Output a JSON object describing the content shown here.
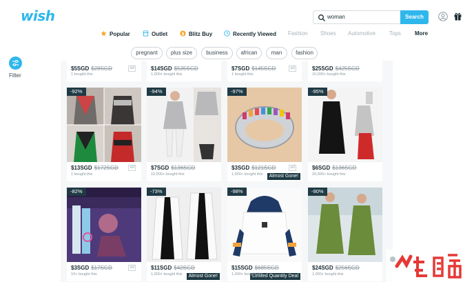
{
  "header": {
    "logo": "wish",
    "search_value": "woman",
    "search_button": "Search"
  },
  "nav": [
    {
      "label": "Popular",
      "style": "strong",
      "icon": "star-icon",
      "color": "#f5a623"
    },
    {
      "label": "Outlet",
      "style": "strong",
      "icon": "store-icon",
      "color": "#2fb7ec"
    },
    {
      "label": "Blitz Buy",
      "style": "strong",
      "icon": "coin-icon",
      "color": "#f5a623"
    },
    {
      "label": "Recently Viewed",
      "style": "strong",
      "icon": "clock-icon",
      "color": "#2fb7ec"
    },
    {
      "label": "Fashion",
      "style": "faded"
    },
    {
      "label": "Shoes",
      "style": "faded"
    },
    {
      "label": "Automotive",
      "style": "faded"
    },
    {
      "label": "Tops",
      "style": "faded"
    },
    {
      "label": "More",
      "style": "strong"
    }
  ],
  "tags": [
    "pregnant",
    "plus size",
    "business",
    "african",
    "man",
    "fashion"
  ],
  "filter": {
    "label": "Filter"
  },
  "products_top": [
    {
      "price": "$5SGD",
      "orig": "$28SGD",
      "bought": "1 bought this",
      "ad": "ad"
    },
    {
      "price": "$14SGD",
      "orig": "$535SGD",
      "bought": "1,000+ bought this"
    },
    {
      "price": "$7SGD",
      "orig": "$145SGD",
      "bought": "1 bought this",
      "ad": "ad"
    },
    {
      "price": "$25SGD",
      "orig": "$425SGD",
      "bought": "10,000+ bought this"
    }
  ],
  "products_row2": [
    {
      "discount": "-92%",
      "price": "$13SGD",
      "orig": "$172SGD",
      "bought": "1 bought this",
      "ad": "ad"
    },
    {
      "discount": "-94%",
      "price": "$7SGD",
      "orig": "$136SGD",
      "bought": "10,000+ bought this"
    },
    {
      "discount": "-97%",
      "price": "$3SGD",
      "orig": "$121SGD",
      "bought": "1,000+ bought this",
      "ad": "ad",
      "badge": "Almost Gone!"
    },
    {
      "discount": "-95%",
      "price": "$6SGD",
      "orig": "$136SGD",
      "bought": "20,000+ bought this"
    }
  ],
  "products_row3": [
    {
      "discount": "-82%",
      "price": "$3SGD",
      "orig": "$17SGD",
      "bought": "10+ bought this",
      "ad": "ad"
    },
    {
      "discount": "-73%",
      "price": "$11SGD",
      "orig": "$42SGD",
      "bought": "1,000+ bought this",
      "badge": "Almost Gone!"
    },
    {
      "discount": "-98%",
      "price": "$15SGD",
      "orig": "$685SGD",
      "bought": "1,000+ bought this",
      "badge": "Limited Quantity Deal"
    },
    {
      "discount": "-90%",
      "price": "$24SGD",
      "orig": "$256SGD",
      "bought": "1,000+ bought this"
    }
  ],
  "colors": {
    "accent": "#2fb7ec",
    "badge": "#1f3a44"
  }
}
